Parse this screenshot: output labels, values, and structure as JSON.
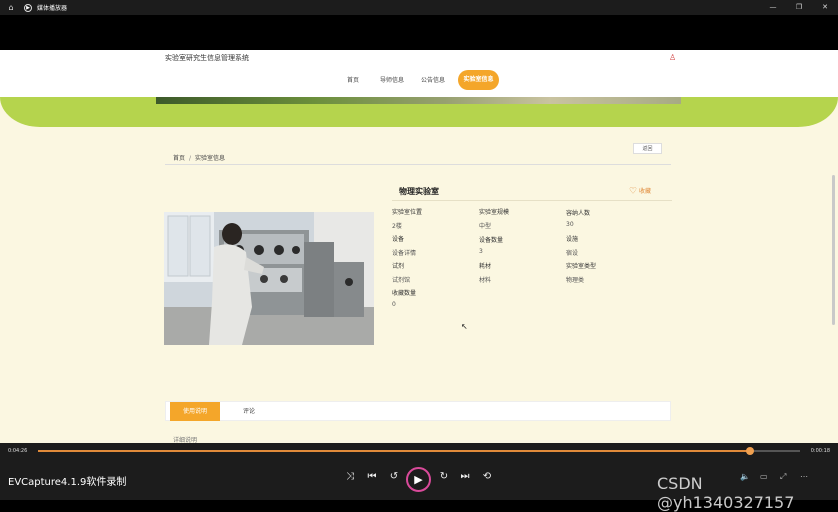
{
  "window": {
    "title": "媒体播放器"
  },
  "site": {
    "title": "实验室研究生信息管理系统"
  },
  "nav": [
    {
      "label": "首页"
    },
    {
      "label": "导师信息"
    },
    {
      "label": "公告信息"
    },
    {
      "label": "实验室信息"
    }
  ],
  "breadcrumb": {
    "home": "首页",
    "sep": "/",
    "current": "实验室信息"
  },
  "return_label": "返回",
  "lab": {
    "name": "物理实验室",
    "fav_label": "收藏",
    "fields": [
      {
        "label": "实验室位置",
        "value": "2楼"
      },
      {
        "label": "实验室规模",
        "value": "中型"
      },
      {
        "label": "容纳人数",
        "value": "30"
      },
      {
        "label": "设备",
        "value": "设备"
      },
      {
        "label": "设备数量",
        "value": "3"
      },
      {
        "label": "设施",
        "value": "宿设"
      },
      {
        "label": "设备详情",
        "value": "设备"
      },
      {
        "label": "试剂",
        "value": "试剂馆"
      },
      {
        "label": "耗材",
        "value": "材料"
      },
      {
        "label": "实验室类型",
        "value": "物理类"
      },
      {
        "label": "收藏数量",
        "value": "0"
      }
    ]
  },
  "tabs": {
    "active": "使用说明",
    "other": "评论"
  },
  "details_label": "详细说明",
  "player": {
    "elapsed": "0:04:26",
    "total": "0:00:18",
    "progress": 0.935,
    "title": "EVCapture4.1.9软件录制"
  },
  "watermark": "CSDN @yh1340327157",
  "colors": {
    "accent": "#f4a62a",
    "green": "#b5d44d",
    "page_bg": "#fbf7e1"
  }
}
